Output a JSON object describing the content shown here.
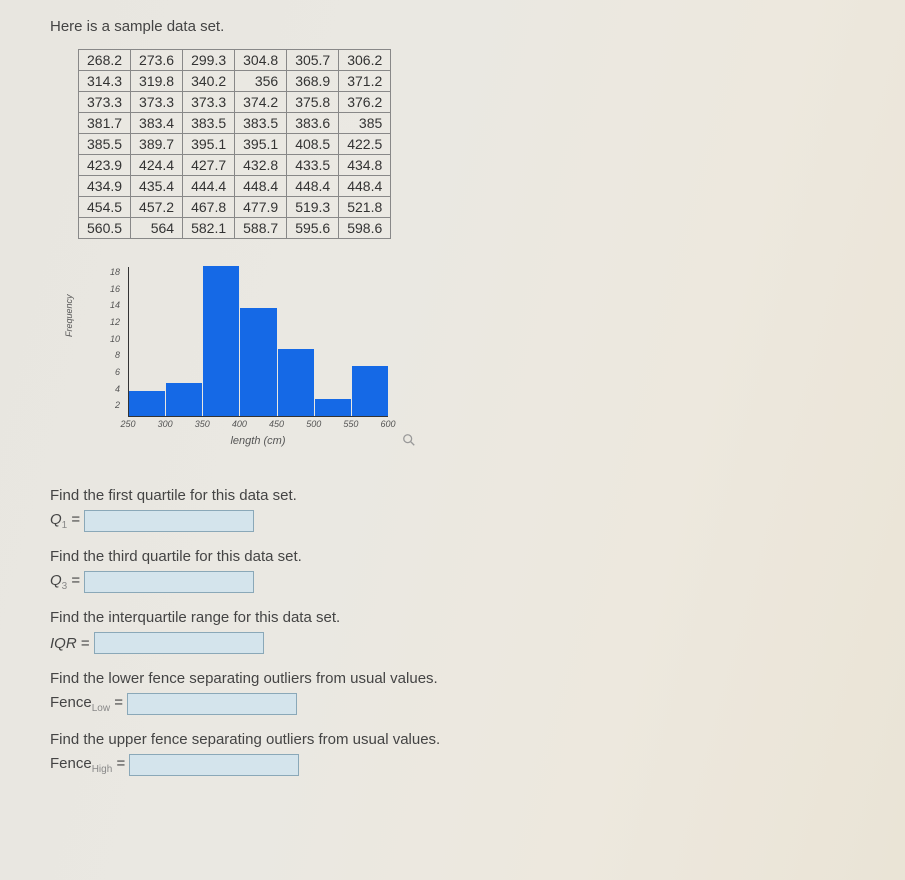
{
  "intro": "Here is a sample data set.",
  "table": [
    [
      "268.2",
      "273.6",
      "299.3",
      "304.8",
      "305.7",
      "306.2"
    ],
    [
      "314.3",
      "319.8",
      "340.2",
      "356",
      "368.9",
      "371.2"
    ],
    [
      "373.3",
      "373.3",
      "373.3",
      "374.2",
      "375.8",
      "376.2"
    ],
    [
      "381.7",
      "383.4",
      "383.5",
      "383.5",
      "383.6",
      "385"
    ],
    [
      "385.5",
      "389.7",
      "395.1",
      "395.1",
      "408.5",
      "422.5"
    ],
    [
      "423.9",
      "424.4",
      "427.7",
      "432.8",
      "433.5",
      "434.8"
    ],
    [
      "434.9",
      "435.4",
      "444.4",
      "448.4",
      "448.4",
      "448.4"
    ],
    [
      "454.5",
      "457.2",
      "467.8",
      "477.9",
      "519.3",
      "521.8"
    ],
    [
      "560.5",
      "564",
      "582.1",
      "588.7",
      "595.6",
      "598.6"
    ]
  ],
  "chart_data": {
    "type": "bar",
    "categories": [
      "250",
      "300",
      "350",
      "400",
      "450",
      "500",
      "550",
      "600"
    ],
    "bins": [
      "250-300",
      "300-350",
      "350-400",
      "400-450",
      "450-500",
      "500-550",
      "550-600"
    ],
    "values": [
      3,
      4,
      18,
      13,
      8,
      2,
      6
    ],
    "ylabel": "Frequency",
    "xlabel": "length (cm)",
    "ylim": [
      0,
      18
    ],
    "yticks": [
      "2",
      "4",
      "6",
      "8",
      "10",
      "12",
      "14",
      "16",
      "18"
    ]
  },
  "q1": {
    "prompt": "Find the first quartile for this data set.",
    "var": "Q",
    "sub": "1",
    "eq": "="
  },
  "q3": {
    "prompt": "Find the third quartile for this data set.",
    "var": "Q",
    "sub": "3",
    "eq": "="
  },
  "iqr": {
    "prompt": "Find the interquartile range for this data set.",
    "var": "IQR",
    "eq": "="
  },
  "low": {
    "prompt": "Find the lower fence separating outliers from usual values.",
    "var": "Fence",
    "sub": "Low",
    "eq": "="
  },
  "high": {
    "prompt": "Find the upper fence separating outliers from usual values.",
    "var": "Fence",
    "sub": "High",
    "eq": "="
  }
}
